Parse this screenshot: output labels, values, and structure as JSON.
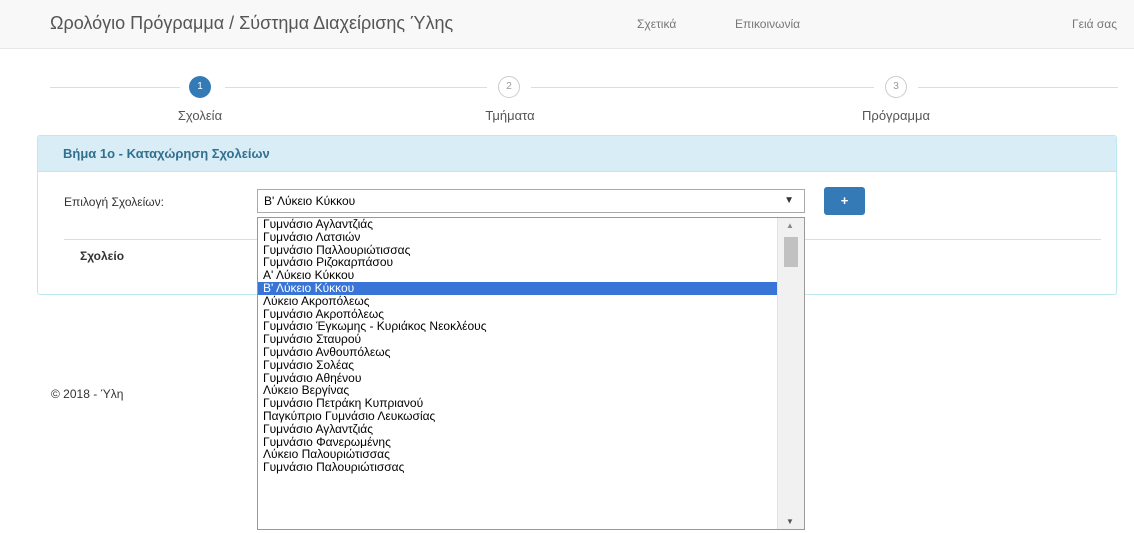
{
  "navbar": {
    "brand": "Ωρολόγιο Πρόγραμμα / Σύστημα Διαχείρισης Ύλης",
    "links": [
      "Σχετικά",
      "Επικοινωνία"
    ],
    "greeting": "Γειά σας"
  },
  "steps": [
    {
      "number": "1",
      "label": "Σχολεία",
      "active": true
    },
    {
      "number": "2",
      "label": "Τμήματα",
      "active": false
    },
    {
      "number": "3",
      "label": "Πρόγραμμα",
      "active": false
    }
  ],
  "panel": {
    "title": "Βήμα 1ο - Καταχώρηση Σχολείων",
    "select_label": "Επιλογή Σχολείων:",
    "selected_value": "Β' Λύκειο Κύκκου",
    "add_button": "+",
    "table_header": "Σχολείο"
  },
  "dropdown": {
    "options": [
      "Γυμνάσιο Αγλαντζιάς",
      "Γυμνάσιο Λατσιών",
      "Γυμνάσιο Παλλουριώτισσας",
      "Γυμνάσιο Ριζοκαρπάσου",
      "Α' Λύκειο Κύκκου",
      "Β' Λύκειο Κύκκου",
      "Λύκειο Ακροπόλεως",
      "Γυμνάσιο Ακροπόλεως",
      "Γυμνάσιο Έγκωμης - Κυριάκος Νεοκλέους",
      "Γυμνάσιο Σταυρού",
      "Γυμνάσιο Ανθουπόλεως",
      "Γυμνάσιο Σολέας",
      "Γυμνάσιο Αθηένου",
      "Λύκειο Βεργίνας",
      "Γυμνάσιο Πετράκη Κυπριανού",
      "Παγκύπριο Γυμνάσιο Λευκωσίας",
      "Γυμνάσιο Αγλαντζιάς",
      "Γυμνάσιο Φανερωμένης",
      "Λύκειο Παλουριώτισσας",
      "Γυμνάσιο Παλουριώτισσας"
    ],
    "selected_index": 5
  },
  "footer": {
    "text": "© 2018 - Ύλη"
  },
  "colors": {
    "accent": "#337ab7",
    "panel_heading_bg": "#d9edf7",
    "panel_title": "#31708f",
    "selected_option_bg": "#3875d7"
  },
  "icons": {
    "select_arrow": "chevron-down-icon",
    "scroll_up": "scroll-up-icon",
    "scroll_down": "scroll-down-icon"
  }
}
